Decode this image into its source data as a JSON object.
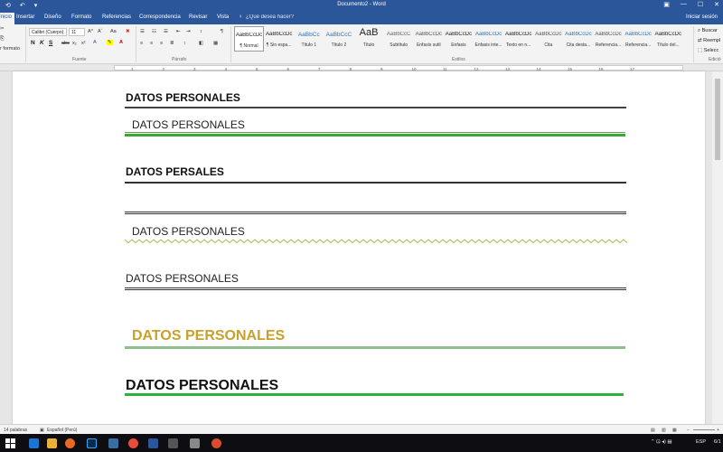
{
  "window": {
    "title": "Documento2 - Word",
    "qat": [
      "⟲",
      "↶",
      "▾"
    ],
    "controls": [
      "▣",
      "—",
      "☐",
      "✕"
    ]
  },
  "tabs": {
    "items": [
      "Inicio",
      "Insertar",
      "Diseño",
      "Formato",
      "Referencias",
      "Correspondencia",
      "Revisar",
      "Vista"
    ],
    "tell_me": "¿Qué desea hacer?",
    "sign_in": "Iniciar sesión"
  },
  "ribbon": {
    "clipboard": {
      "copy_format": "r formato",
      "label": ""
    },
    "font": {
      "name": "Calibri (Cuerpo)",
      "size": "11",
      "grow": "A^",
      "shrink": "Aˇ",
      "clear": "Aa",
      "bold": "N",
      "italic": "K",
      "underline": "S",
      "strike": "abc",
      "sub": "x₂",
      "sup": "x²",
      "label": "Fuente"
    },
    "paragraph": {
      "bullets": "☰",
      "sort": "↕",
      "pilcrow": "¶",
      "label": "Párrafo"
    },
    "styles": {
      "items": [
        {
          "preview": "AaBbCcDc",
          "name": "¶ Normal",
          "color": "#222222"
        },
        {
          "preview": "AaBbCcDc",
          "name": "¶ Sin espa...",
          "color": "#222222"
        },
        {
          "preview": "AaBbCc",
          "name": "Título 1",
          "color": "#2e74b5"
        },
        {
          "preview": "AaBbCcC",
          "name": "Título 2",
          "color": "#2e74b5"
        },
        {
          "preview": "AaB",
          "name": "Título",
          "color": "#222222"
        },
        {
          "preview": "AaBbCcC",
          "name": "Subtítulo",
          "color": "#666666"
        },
        {
          "preview": "AaBbCcDc",
          "name": "Énfasis sutil",
          "color": "#555555"
        },
        {
          "preview": "AaBbCcDc",
          "name": "Énfasis",
          "color": "#222222"
        },
        {
          "preview": "AaBbCcDc",
          "name": "Énfasis inte...",
          "color": "#2e74b5"
        },
        {
          "preview": "AaBbCcDc",
          "name": "Texto en n...",
          "color": "#222222"
        },
        {
          "preview": "AaBbCcDc",
          "name": "Cita",
          "color": "#555555"
        },
        {
          "preview": "AaBbCcDc",
          "name": "Cita desta...",
          "color": "#2e74b5"
        },
        {
          "preview": "AaBbCcDc",
          "name": "Referencia...",
          "color": "#555555"
        },
        {
          "preview": "AaBbCcDc",
          "name": "Referencia...",
          "color": "#2e74b5"
        },
        {
          "preview": "AaBbCcDc",
          "name": "Título del...",
          "color": "#222222"
        }
      ],
      "label": "Estilos"
    },
    "editing": {
      "find": "Buscar",
      "replace": "Reempl",
      "select": "Selecc",
      "label": "Edició"
    }
  },
  "ruler": {
    "ticks": [
      "1",
      "2",
      "3",
      "4",
      "5",
      "6",
      "7",
      "8",
      "9",
      "10",
      "11",
      "12",
      "13",
      "14",
      "15",
      "16",
      "17"
    ]
  },
  "document": {
    "headings": [
      "DATOS PERSONALES",
      "DATOS PERSONALES",
      "DATOS PERSALES",
      "DATOS PERSONALES",
      "DATOS PERSONALES",
      "DATOS PERSONALES",
      "DATOS PERSONALES"
    ]
  },
  "status": {
    "words": "14 palabras",
    "language": "Español (Perú)",
    "zoom": ""
  },
  "taskbar": {
    "lang": "ESP",
    "time": "6/1"
  }
}
